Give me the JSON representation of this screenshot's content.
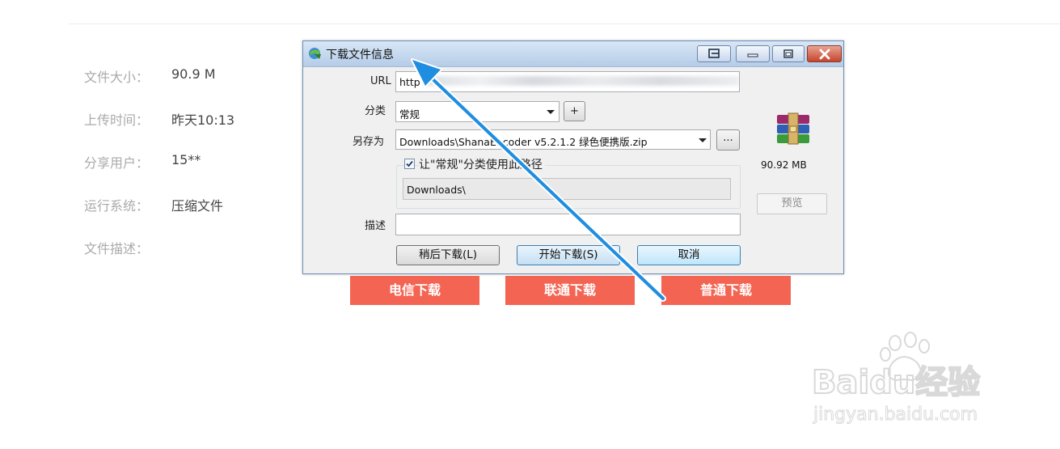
{
  "page": {
    "info": [
      {
        "label": "文件大小：",
        "value": "90.9 M"
      },
      {
        "label": "上传时间：",
        "value": "昨天10:13"
      },
      {
        "label": "分享用户：",
        "value": "15**"
      },
      {
        "label": "运行系统：",
        "value": "压缩文件"
      },
      {
        "label": "文件描述：",
        "value": ""
      }
    ],
    "download_buttons": [
      "电信下载",
      "联通下载",
      "普通下载"
    ]
  },
  "dialog": {
    "title": "下载文件信息",
    "url_label": "URL",
    "url_value": "http",
    "category_label": "分类",
    "category_value": "常规",
    "add_label": "+",
    "saveas_label": "另存为",
    "saveas_value": "Downloads\\ShanaEncoder v5.2.1.2 绿色便携版.zip",
    "browse_label": "...",
    "remember_path_label": "让\"常规\"分类使用此路径",
    "remember_path_checked": true,
    "path_value": "Downloads\\",
    "description_label": "描述",
    "description_value": "",
    "file_size": "90.92  MB",
    "preview_label": "预览",
    "buttons": {
      "later": "稍后下载(L)",
      "start": "开始下载(S)",
      "cancel": "取消"
    }
  },
  "watermark": {
    "brand": "Baidu经验",
    "url": "jingyan.baidu.com"
  },
  "colors": {
    "download_button_bg": "#f46452",
    "annotation_arrow": "#1f8de0",
    "label_gray": "#aaaaaa"
  },
  "icons": [
    "app-icon",
    "winrar-archive-icon",
    "restore-icon",
    "minimize-icon",
    "maximize-icon",
    "close-icon",
    "dropdown-arrow-icon",
    "checkbox-check-icon"
  ]
}
